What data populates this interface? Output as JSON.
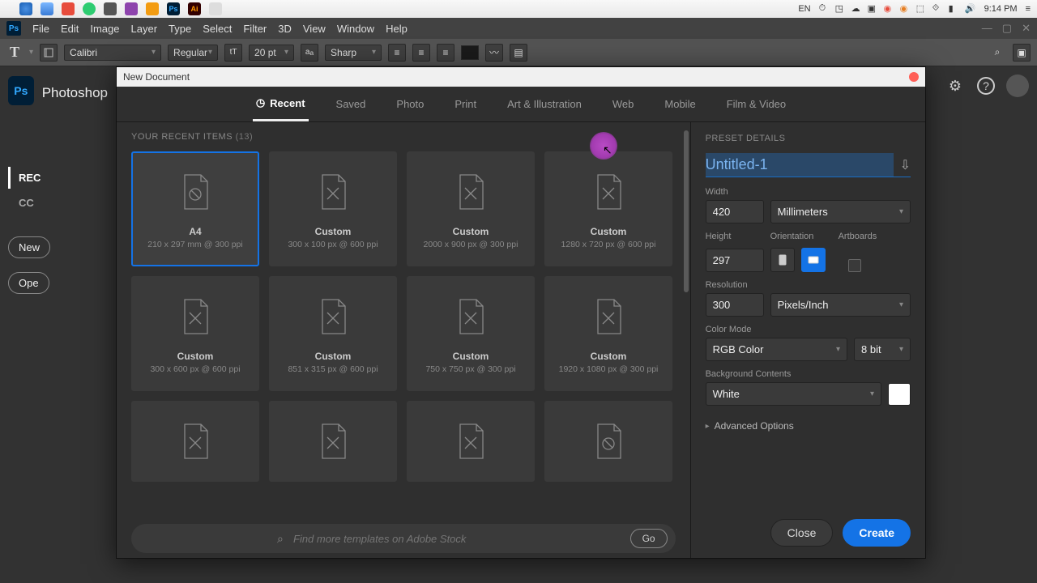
{
  "mac": {
    "lang": "EN",
    "clock": "9:14 PM"
  },
  "app_menu": [
    "File",
    "Edit",
    "Image",
    "Layer",
    "Type",
    "Select",
    "Filter",
    "3D",
    "View",
    "Window",
    "Help"
  ],
  "opts": {
    "font": "Calibri",
    "weight": "Regular",
    "size": "20 pt",
    "aa": "Sharp"
  },
  "home": {
    "name": "Photoshop",
    "rec": "REC",
    "cc": "CC",
    "new": "New",
    "open": "Ope"
  },
  "dialog": {
    "title": "New Document",
    "tabs": [
      "Recent",
      "Saved",
      "Photo",
      "Print",
      "Art & Illustration",
      "Web",
      "Mobile",
      "Film & Video"
    ],
    "recents_label": "YOUR RECENT ITEMS",
    "recents_count": "(13)",
    "search_placeholder": "Find more templates on Adobe Stock",
    "go": "Go",
    "cards": [
      {
        "t": "A4",
        "s": "210 x 297 mm @ 300 ppi",
        "icon": "a4"
      },
      {
        "t": "Custom",
        "s": "300 x 100 px @ 600 ppi",
        "icon": "x"
      },
      {
        "t": "Custom",
        "s": "2000 x 900 px @ 300 ppi",
        "icon": "x"
      },
      {
        "t": "Custom",
        "s": "1280 x 720 px @ 600 ppi",
        "icon": "x"
      },
      {
        "t": "Custom",
        "s": "300 x 600 px @ 600 ppi",
        "icon": "x"
      },
      {
        "t": "Custom",
        "s": "851 x 315 px @ 600 ppi",
        "icon": "x"
      },
      {
        "t": "Custom",
        "s": "750 x 750 px @ 300 ppi",
        "icon": "x"
      },
      {
        "t": "Custom",
        "s": "1920 x 1080 px @ 300 ppi",
        "icon": "x"
      }
    ]
  },
  "details": {
    "header": "PRESET DETAILS",
    "doc_name": "Untitled-1",
    "width_label": "Width",
    "width": "420",
    "width_unit": "Millimeters",
    "height_label": "Height",
    "height": "297",
    "orient_label": "Orientation",
    "artboards_label": "Artboards",
    "res_label": "Resolution",
    "res": "300",
    "res_unit": "Pixels/Inch",
    "color_label": "Color Mode",
    "color_mode": "RGB Color",
    "bit_depth": "8 bit",
    "bg_label": "Background Contents",
    "bg": "White",
    "advanced": "Advanced Options",
    "close": "Close",
    "create": "Create"
  }
}
